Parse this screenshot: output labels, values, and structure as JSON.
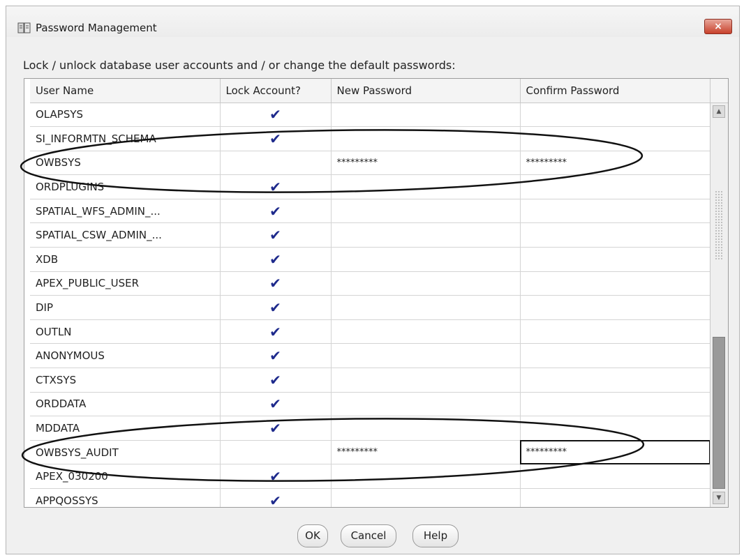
{
  "window": {
    "title": "Password Management",
    "close_label": "×"
  },
  "instruction": "Lock / unlock database user accounts and / or change the default passwords:",
  "table": {
    "columns": [
      "User Name",
      "Lock Account?",
      "New Password",
      "Confirm Password"
    ],
    "rows": [
      {
        "user": "OLAPSYS",
        "lock": "✔",
        "new_password": "",
        "confirm_password": ""
      },
      {
        "user": "SI_INFORMTN_SCHEMA",
        "lock": "✔",
        "new_password": "",
        "confirm_password": ""
      },
      {
        "user": "OWBSYS",
        "lock": "",
        "new_password": "*********",
        "confirm_password": "*********"
      },
      {
        "user": "ORDPLUGINS",
        "lock": "✔",
        "new_password": "",
        "confirm_password": ""
      },
      {
        "user": "SPATIAL_WFS_ADMIN_...",
        "lock": "✔",
        "new_password": "",
        "confirm_password": ""
      },
      {
        "user": "SPATIAL_CSW_ADMIN_...",
        "lock": "✔",
        "new_password": "",
        "confirm_password": ""
      },
      {
        "user": "XDB",
        "lock": "✔",
        "new_password": "",
        "confirm_password": ""
      },
      {
        "user": "APEX_PUBLIC_USER",
        "lock": "✔",
        "new_password": "",
        "confirm_password": ""
      },
      {
        "user": "DIP",
        "lock": "✔",
        "new_password": "",
        "confirm_password": ""
      },
      {
        "user": "OUTLN",
        "lock": "✔",
        "new_password": "",
        "confirm_password": ""
      },
      {
        "user": "ANONYMOUS",
        "lock": "✔",
        "new_password": "",
        "confirm_password": ""
      },
      {
        "user": "CTXSYS",
        "lock": "✔",
        "new_password": "",
        "confirm_password": ""
      },
      {
        "user": "ORDDATA",
        "lock": "✔",
        "new_password": "",
        "confirm_password": ""
      },
      {
        "user": "MDDATA",
        "lock": "✔",
        "new_password": "",
        "confirm_password": ""
      },
      {
        "user": "OWBSYS_AUDIT",
        "lock": "",
        "new_password": "*********",
        "confirm_password": "*********"
      },
      {
        "user": "APEX_030200",
        "lock": "✔",
        "new_password": "",
        "confirm_password": ""
      },
      {
        "user": "APPQOSSYS",
        "lock": "✔",
        "new_password": "",
        "confirm_password": ""
      }
    ]
  },
  "buttons": {
    "ok": "OK",
    "cancel": "Cancel",
    "help": "Help"
  },
  "colors": {
    "checkmark": "#1e2a8c",
    "close_button": "#c8412b"
  }
}
